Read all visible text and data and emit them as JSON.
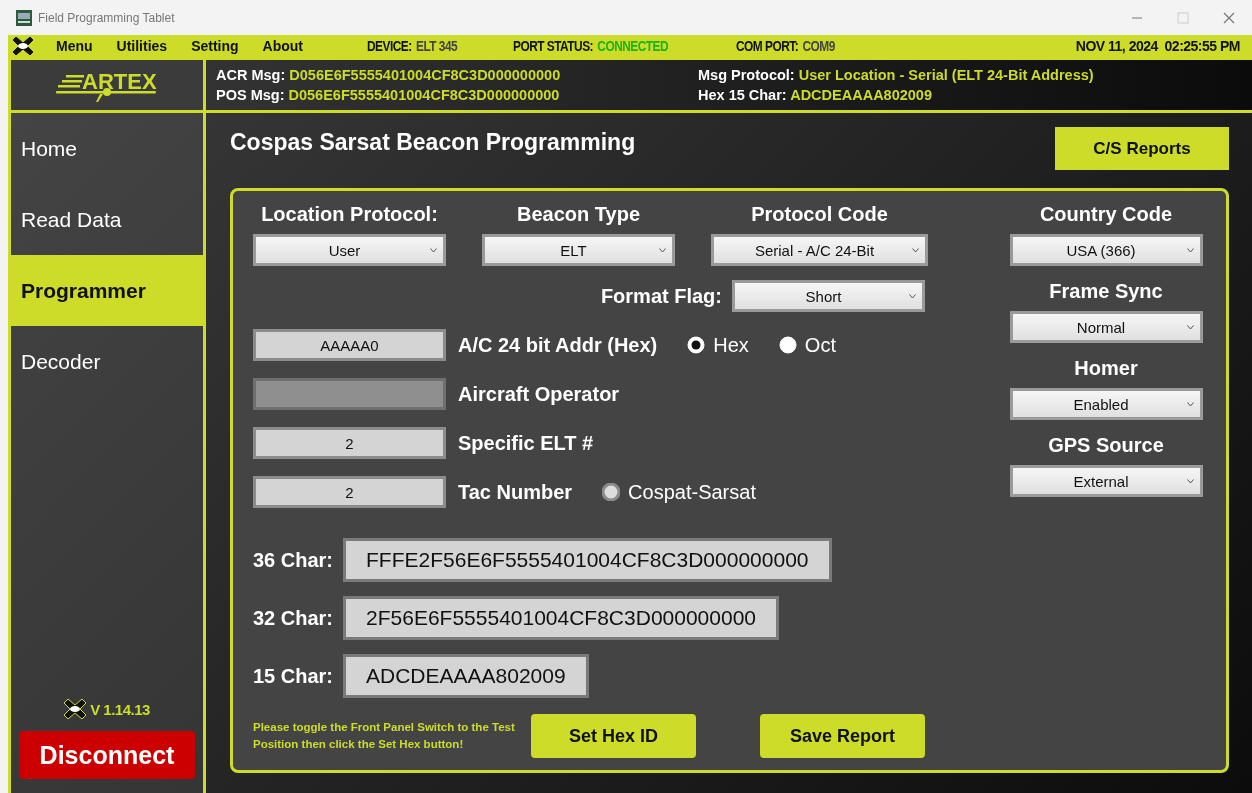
{
  "window": {
    "title": "Field Programming Tablet"
  },
  "menu_bar": {
    "items": [
      "Menu",
      "Utilities",
      "Setting",
      "About"
    ],
    "status": [
      {
        "label": "DEVICE:",
        "value": "ELT 345",
        "kind": "plain"
      },
      {
        "label": "PORT STATUS:",
        "value": "CONNECTED",
        "kind": "ok"
      },
      {
        "label": "COM PORT:",
        "value": "COM9",
        "kind": "plain"
      }
    ],
    "datetime": "NOV 11, 2024  02:25:55 PM"
  },
  "header": {
    "logo_text": "ARTEX",
    "messages": [
      {
        "label": "ACR Msg:",
        "value": "D056E6F5555401004CF8C3D000000000"
      },
      {
        "label": "POS Msg:",
        "value": "D056E6F5555401004CF8C3D000000000"
      },
      {
        "label": "Msg Protocol:",
        "value": "User Location - Serial (ELT 24-Bit Address)"
      },
      {
        "label": "Hex 15 Char:",
        "value": "ADCDEAAAA802009"
      }
    ]
  },
  "sidebar": {
    "items": [
      {
        "label": "Home",
        "selected": false
      },
      {
        "label": "Read Data",
        "selected": false
      },
      {
        "label": "Programmer",
        "selected": true
      },
      {
        "label": "Decoder",
        "selected": false
      }
    ],
    "version": "V 1.14.13",
    "disconnect_button": "Disconnect"
  },
  "main": {
    "title": "Cospas Sarsat Beacon Programming",
    "reports_button": "C/S Reports",
    "top_dropdowns": [
      {
        "label": "Location Protocol:",
        "value": "User"
      },
      {
        "label": "Beacon Type",
        "value": "ELT"
      },
      {
        "label": "Protocol Code",
        "value": "Serial - A/C 24-Bit"
      }
    ],
    "format_flag": {
      "label": "Format Flag:",
      "value": "Short"
    },
    "fields": [
      {
        "value": "AAAAA0",
        "label": "A/C 24 bit Addr (Hex)",
        "disabled": false,
        "radios": [
          {
            "label": "Hex",
            "selected": true,
            "disabled": false
          },
          {
            "label": "Oct",
            "selected": false,
            "disabled": false
          }
        ]
      },
      {
        "label": "Aircraft Operator",
        "disabled": true
      },
      {
        "value": "2",
        "label": "Specific ELT #",
        "disabled": false
      },
      {
        "value": "2",
        "label": "Tac Number",
        "disabled": false,
        "radios": [
          {
            "label": "Cospat-Sarsat",
            "selected": false,
            "disabled": true
          }
        ]
      }
    ],
    "hex_outputs": [
      {
        "label": "36 Char:",
        "value": "FFFE2F56E6F5555401004CF8C3D000000000"
      },
      {
        "label": "32 Char:",
        "value": "2F56E6F5555401004CF8C3D000000000"
      },
      {
        "label": "15 Char:",
        "value": "ADCDEAAAA802009"
      }
    ],
    "right_dropdowns": [
      {
        "label": "Country Code",
        "value": "USA (366)"
      },
      {
        "label": "Frame Sync",
        "value": "Normal"
      },
      {
        "label": "Homer",
        "value": "Enabled"
      },
      {
        "label": "GPS Source",
        "value": "External"
      }
    ],
    "note": "Please toggle the Front Panel Switch to the Test Position then click the Set Hex button!",
    "buttons": [
      "Set Hex ID",
      "Save Report"
    ]
  }
}
